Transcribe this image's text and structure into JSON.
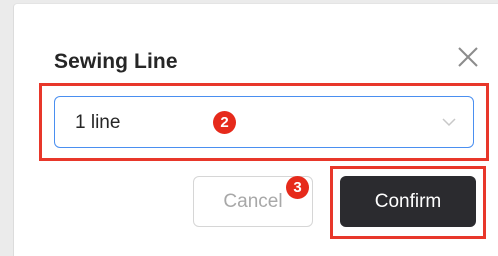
{
  "dialog": {
    "title": "Sewing Line",
    "close_icon": "close-icon"
  },
  "select": {
    "value": "1 line",
    "arrow_icon": "chevron-down-icon"
  },
  "buttons": {
    "cancel_label": "Cancel",
    "confirm_label": "Confirm"
  },
  "annotations": {
    "badge_select": "2",
    "badge_cancel": "3",
    "highlight_color": "#e8372a",
    "badge_color": "#e62a1b"
  }
}
